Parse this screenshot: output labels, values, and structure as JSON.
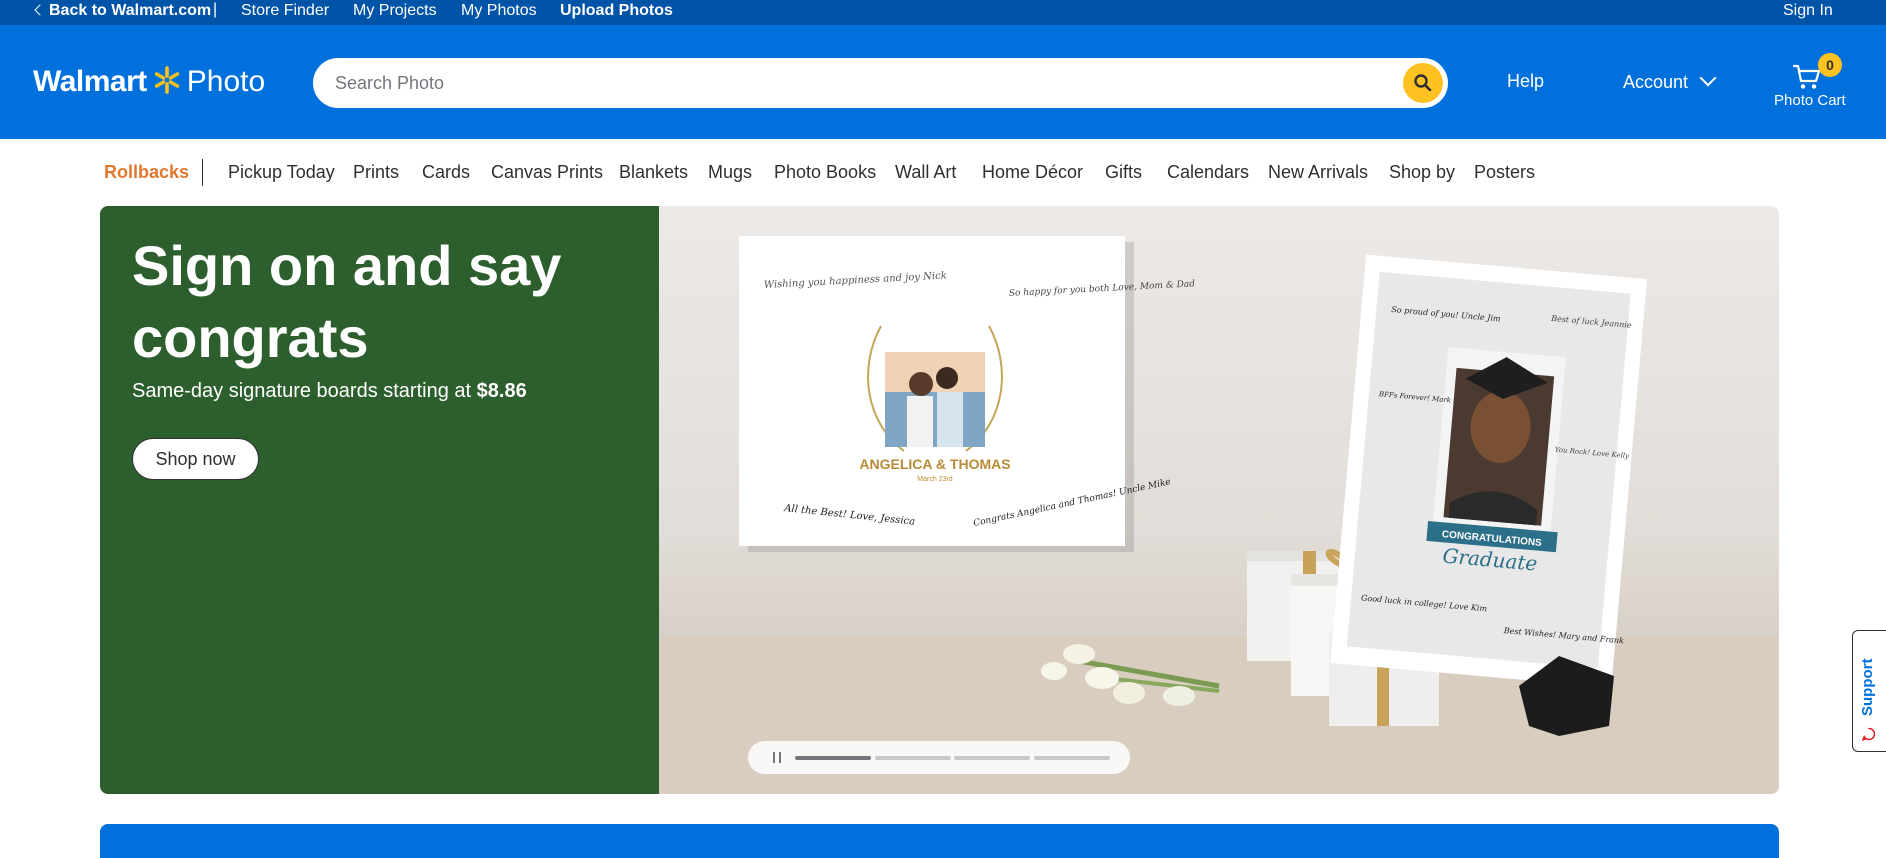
{
  "utility": {
    "back": "Back to Walmart.com",
    "separator": "|",
    "store_finder": "Store Finder",
    "my_projects": "My Projects",
    "my_photos": "My Photos",
    "upload_photos": "Upload Photos",
    "sign_in": "Sign In"
  },
  "header": {
    "logo_walmart": "Walmart",
    "logo_photo": "Photo",
    "search_placeholder": "Search Photo",
    "search_value": "",
    "help": "Help",
    "account": "Account",
    "cart_count": "0",
    "cart_label": "Photo Cart"
  },
  "nav": {
    "items": [
      "Rollbacks",
      "Pickup Today",
      "Prints",
      "Cards",
      "Canvas Prints",
      "Blankets",
      "Mugs",
      "Photo Books",
      "Wall Art",
      "Home Décor",
      "Gifts",
      "Calendars",
      "New Arrivals",
      "Shop by",
      "Posters"
    ]
  },
  "hero": {
    "title": "Sign on and say congrats",
    "subtitle_prefix": "Same-day signature boards starting at ",
    "subtitle_price": "$8.86",
    "cta": "Shop now",
    "board1": {
      "names": "ANGELICA & THOMAS",
      "date": "March 23rd",
      "sig_tl": "Wishing you happiness and joy Nick",
      "sig_tr": "So happy for you both Love, Mom & Dad",
      "sig_bl": "All the Best! Love, Jessica",
      "sig_br": "Congrats Angelica and Thomas! Uncle Mike"
    },
    "board2": {
      "banner": "CONGRATULATIONS",
      "script": "Graduate",
      "sig_tl": "So proud of you! Uncle Jim",
      "sig_tr": "Best of luck Jeannie",
      "sig_ml": "BFFs Forever! Mark",
      "sig_mr": "You Rock! Love Kelly",
      "sig_bl": "Good luck in college! Love Kim",
      "sig_br": "Best Wishes! Mary and Frank"
    }
  },
  "support": {
    "label": "Support"
  },
  "colors": {
    "utility_bar": "#0054a8",
    "header": "#0071dc",
    "accent_yellow": "#ffc220",
    "hero_green": "#2d5e2d",
    "rollbacks": "#e0782e"
  },
  "icons": {
    "back": "chevron-left-icon",
    "logo": "spark-icon",
    "search": "search-icon",
    "account": "chevron-down-icon",
    "cart": "cart-icon",
    "pause": "pause-icon",
    "support": "chat-icon"
  }
}
